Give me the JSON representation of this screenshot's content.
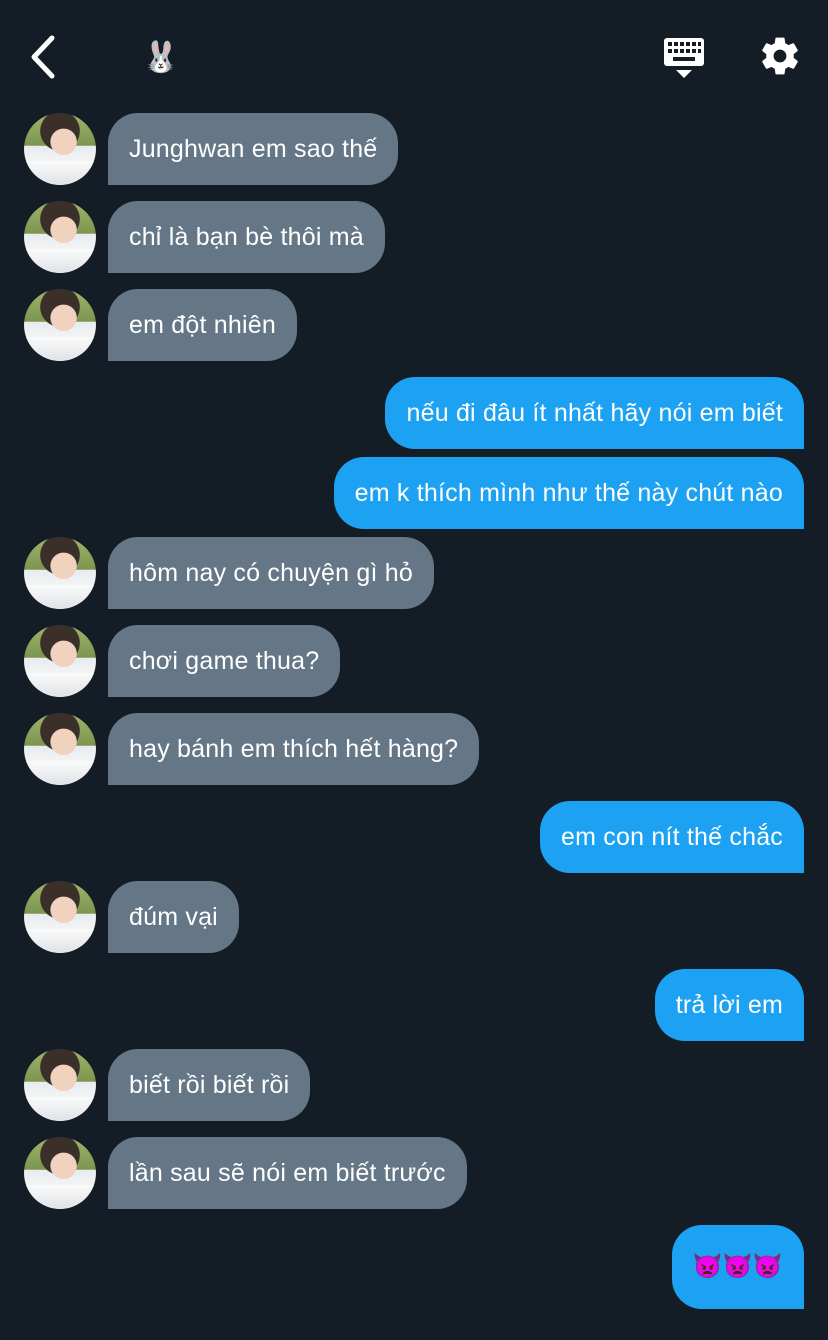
{
  "header": {
    "title_emoji": "🐰",
    "icons": {
      "back": "back-arrow-icon",
      "keyboard": "keyboard-icon",
      "settings": "gear-icon"
    }
  },
  "colors": {
    "background": "#141d26",
    "incoming": "#657786",
    "outgoing": "#1da1f2"
  },
  "messages": [
    {
      "side": "in",
      "text": "Junghwan em sao thế"
    },
    {
      "side": "in",
      "text": "chỉ là bạn bè thôi mà"
    },
    {
      "side": "in",
      "text": "em đột nhiên"
    },
    {
      "side": "out",
      "text": "nếu đi đâu ít nhất hãy nói em biết"
    },
    {
      "side": "out",
      "text": "em k thích mình như thế này chút nào"
    },
    {
      "side": "in",
      "text": "hôm nay có chuyện gì hỏ"
    },
    {
      "side": "in",
      "text": "chơi game thua?"
    },
    {
      "side": "in",
      "text": "hay bánh em thích hết hàng?"
    },
    {
      "side": "out",
      "text": "em con nít thế chắc"
    },
    {
      "side": "in",
      "text": "đúm vại"
    },
    {
      "side": "out",
      "text": "trả lời em"
    },
    {
      "side": "in",
      "text": "biết rồi biết rồi"
    },
    {
      "side": "in",
      "text": "lần sau sẽ nói em biết trước"
    },
    {
      "side": "out",
      "text": "👿👿👿"
    }
  ]
}
